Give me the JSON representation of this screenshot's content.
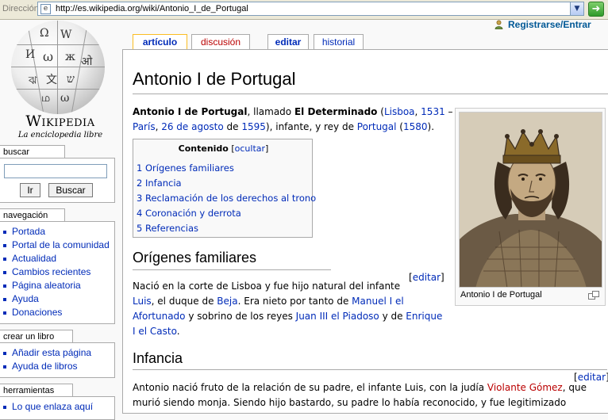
{
  "browser": {
    "address_label": "Dirección",
    "url": "http://es.wikipedia.org/wiki/Antonio_I_de_Portugal"
  },
  "logo": {
    "wordmark": "Wikipedia",
    "tagline": "La enciclopedia libre"
  },
  "personal": {
    "login": "Registrarse/Entrar"
  },
  "tabs": [
    {
      "label": "artículo"
    },
    {
      "label": "discusión"
    },
    {
      "label": "editar"
    },
    {
      "label": "historial"
    }
  ],
  "sidebar": {
    "search": {
      "header": "buscar",
      "go_button": "Ir",
      "search_button": "Buscar"
    },
    "navigation": {
      "header": "navegación",
      "items": [
        "Portada",
        "Portal de la comunidad",
        "Actualidad",
        "Cambios recientes",
        "Página aleatoria",
        "Ayuda",
        "Donaciones"
      ]
    },
    "book": {
      "header": "crear un libro",
      "items": [
        "Añadir esta página",
        "Ayuda de libros"
      ]
    },
    "tools": {
      "header": "herramientas",
      "items": [
        "Lo que enlaza aquí"
      ]
    }
  },
  "article": {
    "title": "Antonio I de Portugal",
    "intro": {
      "name": "Antonio I de Portugal",
      "t1": ", llamado ",
      "epithet": "El Determinado",
      "t2": " (",
      "birth_city": "Lisboa",
      "t3": ", ",
      "birth_year": "1531",
      "t4": " –",
      "death_city": "París",
      "t5": ", ",
      "death_date": "26 de agosto",
      "t6": " de ",
      "death_year": "1595",
      "t7": "), infante, y rey de ",
      "country": "Portugal",
      "t8": " (",
      "reign_year": "1580",
      "t9": ")."
    },
    "toc": {
      "title": "Contenido",
      "toggle": "ocultar",
      "items": [
        "1 Orígenes familiares",
        "2 Infancia",
        "3 Reclamación de los derechos al trono",
        "4 Coronación y derrota",
        "5 Referencias"
      ]
    },
    "edit_label": "editar",
    "sections": {
      "origenes": {
        "heading": "Orígenes familiares",
        "l1": "Nació en la corte de Lisboa y fue hijo natural del infante",
        "l2_link1": "Luis",
        "l2_t1": ", el duque de ",
        "l2_link2": "Beja",
        "l2_t2": ". Era nieto por tanto de ",
        "l2_link3": "Manuel I el",
        "l3_link3": "Afortunado",
        "l3_t1": " y sobrino de los reyes ",
        "l3_link4": "Juan III el Piadoso",
        "l3_t2": " y de ",
        "l3_link5": "Enrique",
        "l4_link5": "I el Casto",
        "l4_t1": "."
      },
      "infancia": {
        "heading": "Infancia",
        "l1_t1": "Antonio nació fruto de la relación de su padre, el infante Luis, con la judía ",
        "l1_link": "Violante Gómez",
        "l1_t2": ", que",
        "l2": "murió siendo monja. Siendo hijo bastardo, su padre lo había reconocido, y fue legitimizado"
      }
    },
    "thumb": {
      "caption": "Antonio I de Portugal"
    }
  }
}
